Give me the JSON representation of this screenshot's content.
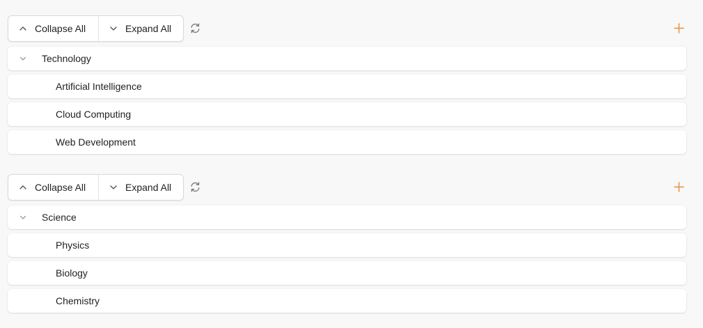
{
  "toolbar": {
    "collapse_all_label": "Collapse All",
    "expand_all_label": "Expand All"
  },
  "colors": {
    "accent": "#e8913a",
    "icon_gray": "#7a7a7a",
    "background": "#f8f8f8"
  },
  "trees": [
    {
      "parent": "Technology",
      "children": [
        "Artificial Intelligence",
        "Cloud Computing",
        "Web Development"
      ]
    },
    {
      "parent": "Science",
      "children": [
        "Physics",
        "Biology",
        "Chemistry"
      ]
    }
  ],
  "icons": {
    "collapse": "chevron-up-icon",
    "expand": "chevron-down-icon",
    "refresh": "refresh-icon",
    "add": "plus-icon",
    "caret": "chevron-down-icon"
  }
}
